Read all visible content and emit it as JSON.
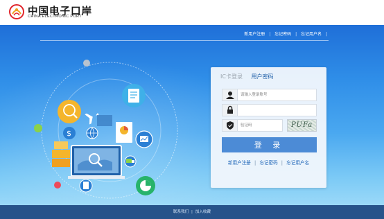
{
  "header": {
    "logo_cn": "中国电子口岸",
    "logo_en": "CHINA ELECTRONIC PORT"
  },
  "top_links": [
    "新用户注册",
    "忘记密码",
    "忘记用户名"
  ],
  "login": {
    "tabs": [
      "IC卡登录",
      "用户密码"
    ],
    "active_tab": "用户密码",
    "username_placeholder": "请输入登录账号",
    "password_value": "",
    "captcha_placeholder": "验证码",
    "captcha_text": "PUFa",
    "submit_label": "登 录",
    "links": [
      "新用户注册",
      "忘记密码",
      "忘记用户名"
    ]
  },
  "footer": {
    "links": [
      "联系我们",
      "加入收藏"
    ]
  },
  "colors": {
    "bg_top": "#1f6fd8",
    "bg_bottom": "#9bd9f8",
    "button": "#4c8bd6",
    "link": "#1f66b8",
    "footer": "#27538a"
  },
  "icons": [
    "user-icon",
    "lock-icon",
    "shield-icon",
    "globe-icon",
    "airplane-icon",
    "dollar-icon",
    "pie-chart-icon",
    "document-icon"
  ]
}
